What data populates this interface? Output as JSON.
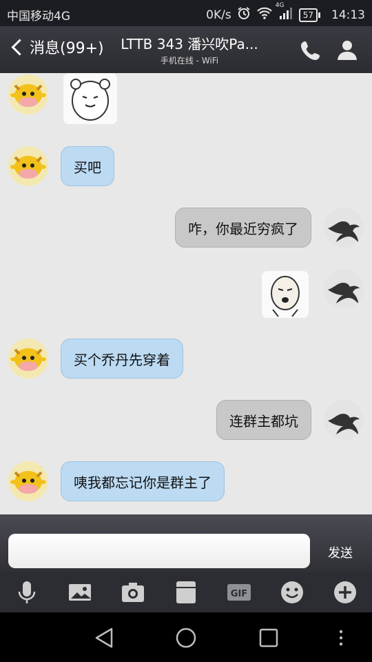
{
  "status_bar": {
    "carrier": "中国移动4G",
    "net_speed": "0K/s",
    "network_type": "4G",
    "battery": "57",
    "time": "14:13"
  },
  "header": {
    "back_label": "消息(99+)",
    "title": "LTTB 343 潘兴吹Pa...",
    "subtitle": "手机在线 - WiFi"
  },
  "messages": [
    {
      "side": "in",
      "kind": "sticker",
      "icon": "bear-sticker"
    },
    {
      "side": "in",
      "kind": "text",
      "text": "买吧"
    },
    {
      "side": "out",
      "kind": "text",
      "text": "咋，你最近穷疯了"
    },
    {
      "side": "out",
      "kind": "sticker",
      "icon": "face-sticker"
    },
    {
      "side": "in",
      "kind": "text",
      "text": "买个乔丹先穿着"
    },
    {
      "side": "out",
      "kind": "text",
      "text": "连群主都坑"
    },
    {
      "side": "in",
      "kind": "text",
      "text": "咦我都忘记你是群主了"
    }
  ],
  "input": {
    "placeholder": "",
    "value": "",
    "send_label": "发送"
  },
  "toolbar": [
    "microphone-icon",
    "picture-icon",
    "camera-icon",
    "file-icon",
    "gif-icon",
    "emoji-icon",
    "plus-icon"
  ],
  "navbar": [
    "back-icon",
    "home-icon",
    "recents-icon",
    "more-icon"
  ]
}
